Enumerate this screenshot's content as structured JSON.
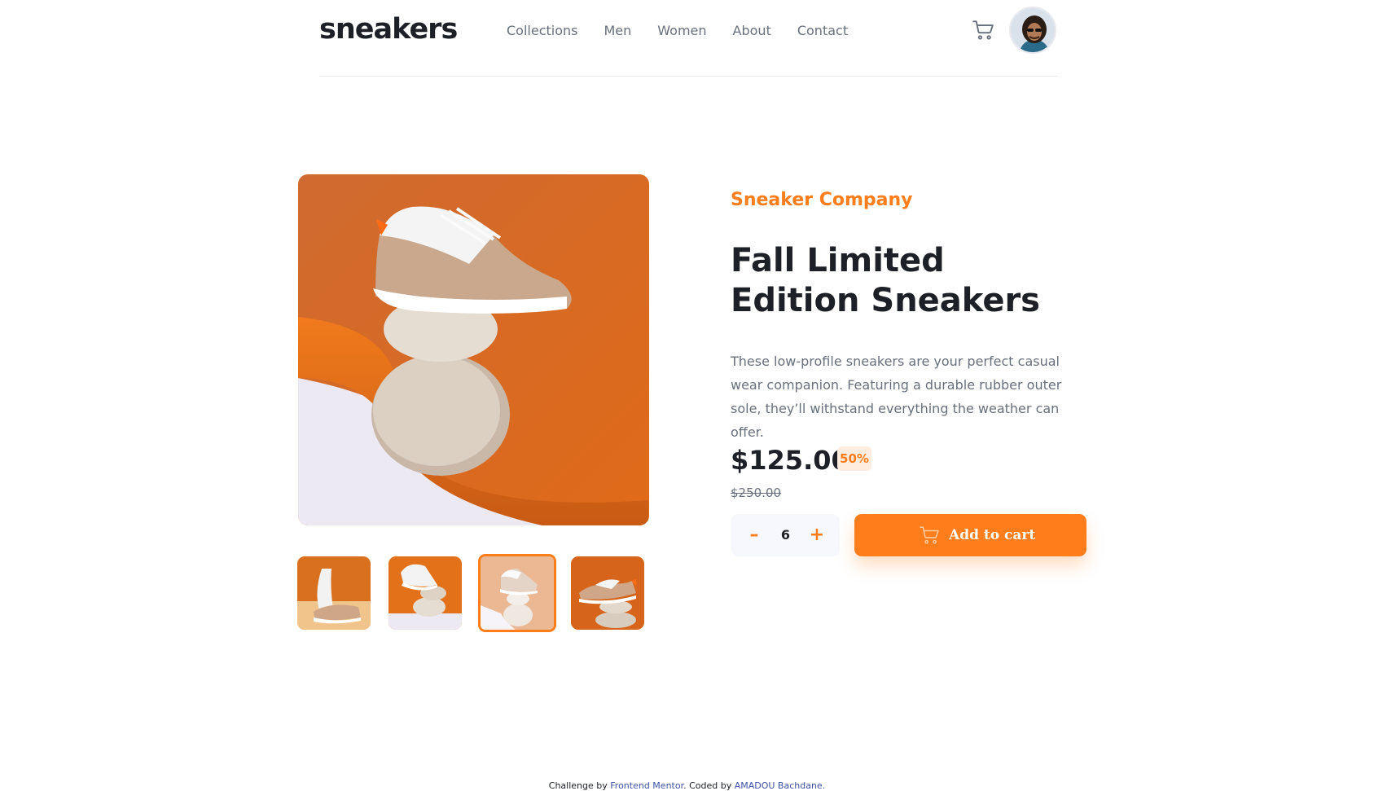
{
  "header": {
    "logo": "sneakers",
    "nav": [
      "Collections",
      "Men",
      "Women",
      "About",
      "Contact"
    ],
    "cart_icon": "cart-icon",
    "avatar_icon": "avatar-image"
  },
  "product": {
    "company": "Sneaker Company",
    "title": "Fall Limited Edition Sneakers",
    "description": "These low-profile sneakers are your perfect casual wear companion. Featuring a durable rubber outer sole, they’ll withstand everything the weather can offer.",
    "price": "$125.00",
    "discount": "50%",
    "old_price": "$250.00",
    "quantity": "6",
    "minus_label": "–",
    "plus_label": "+",
    "add_to_cart": "Add to cart",
    "thumbnails_active_index": 3
  },
  "footer": {
    "prefix": "Challenge by",
    "challenge_by": "Frontend Mentor",
    "mid": ". Coded by",
    "coded_by": "AMADOU Bachdane."
  },
  "colors": {
    "accent": "#ff7e1b",
    "accent_pale": "#ffede0",
    "text_dark": "#1d2026",
    "text_gray": "#69707d",
    "light_bg": "#f6f8fd"
  }
}
